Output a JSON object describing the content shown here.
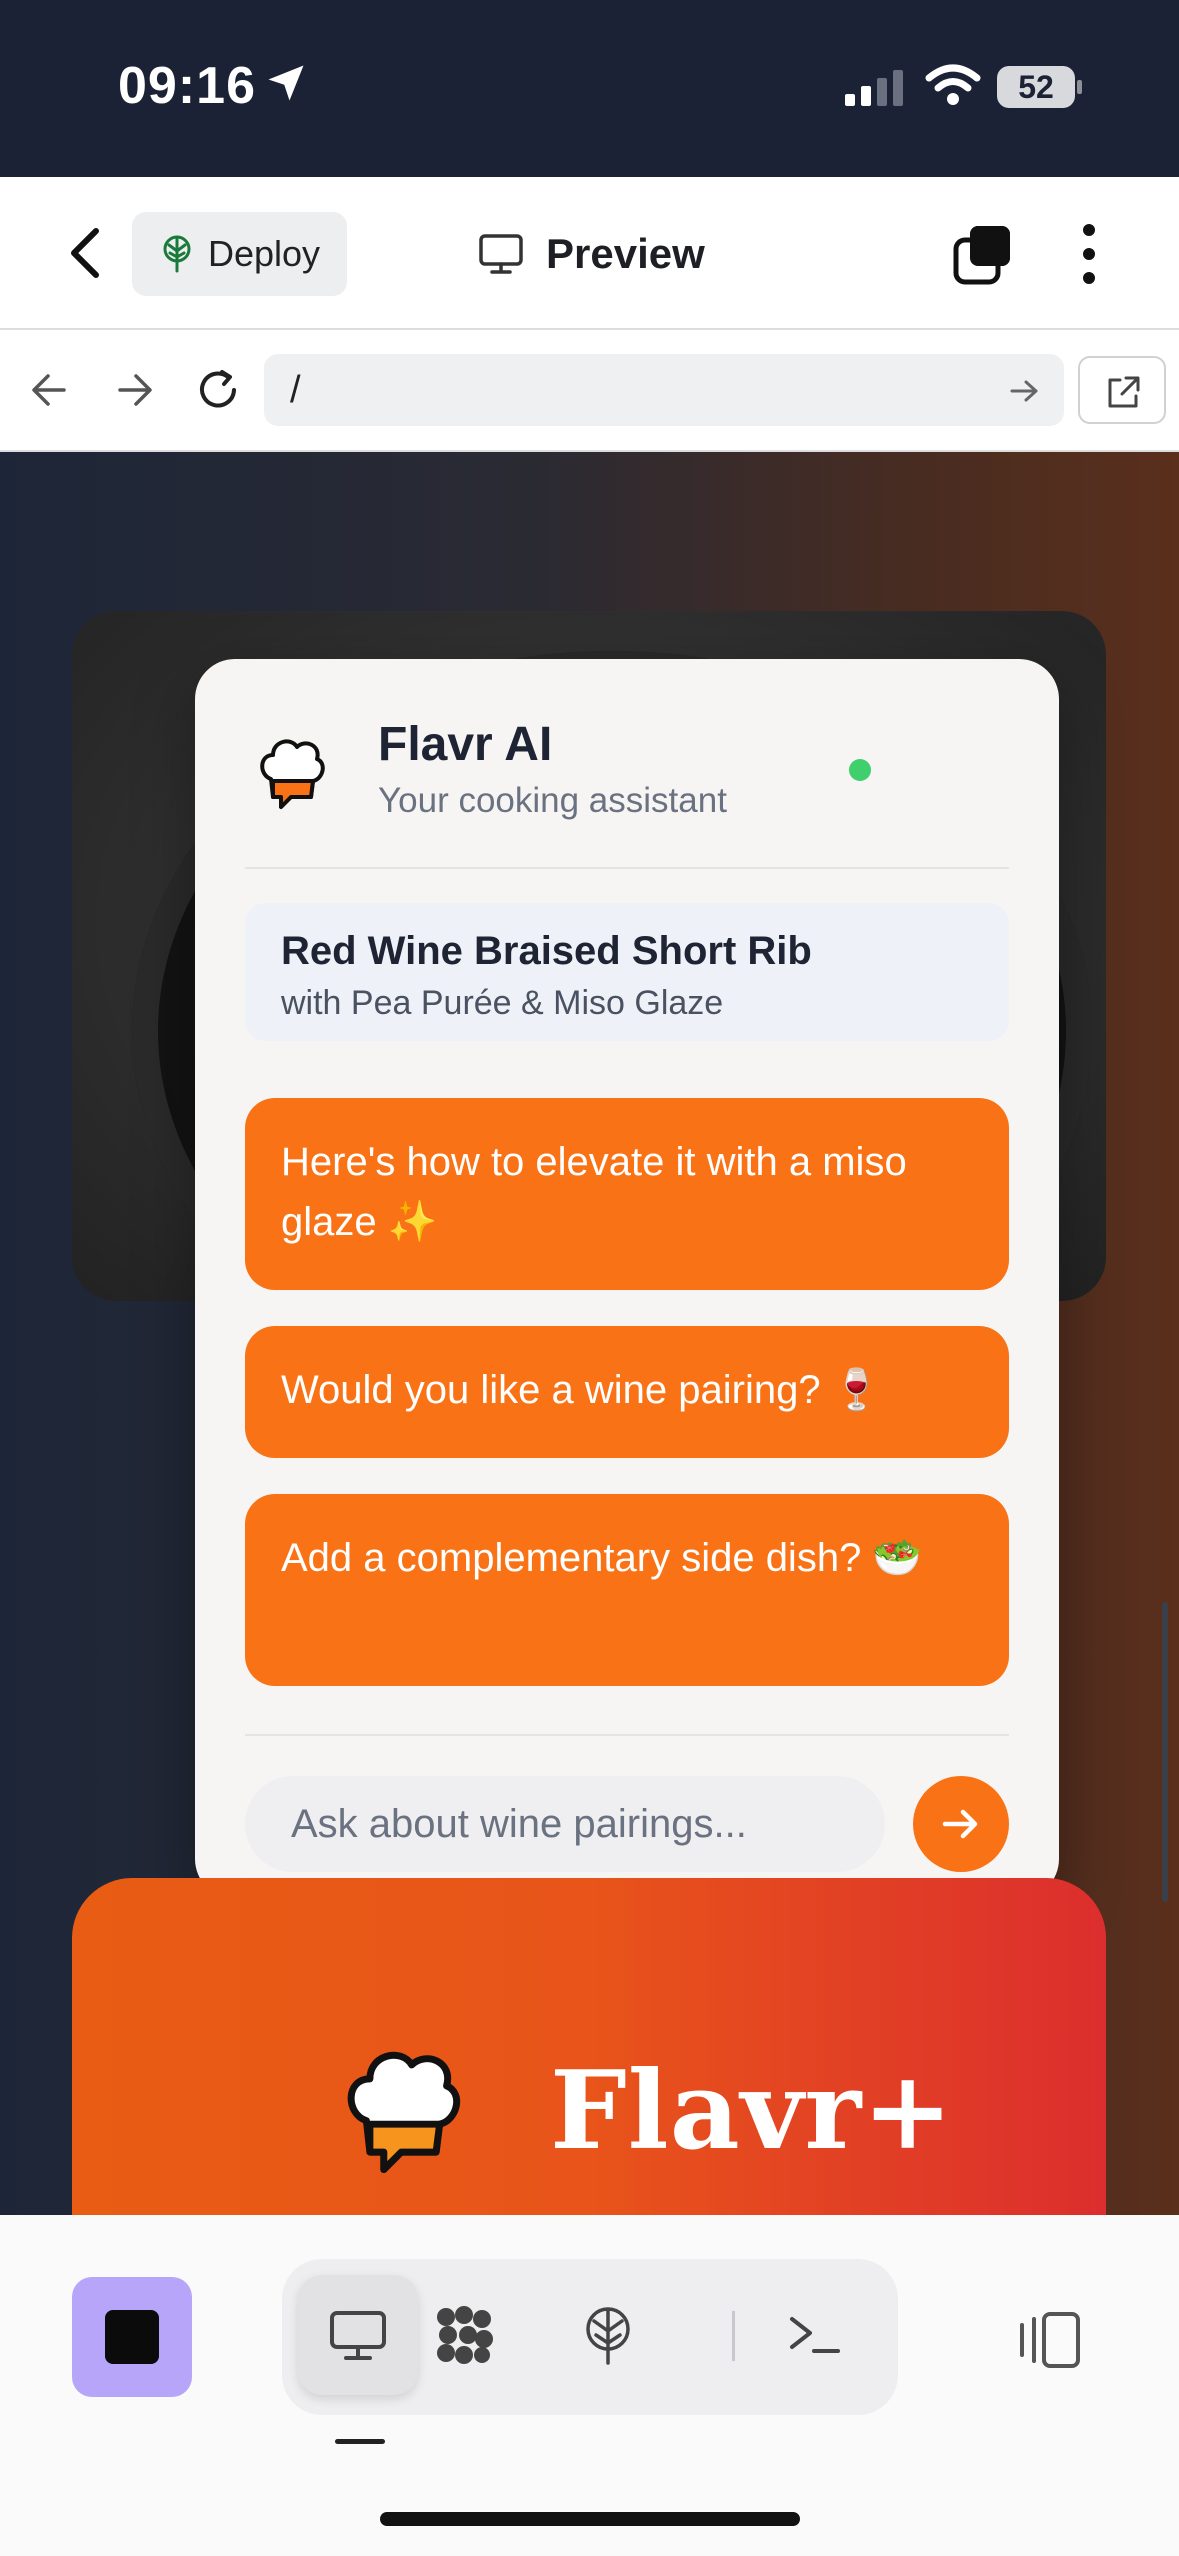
{
  "status_bar": {
    "time": "09:16",
    "battery": "52"
  },
  "app_bar": {
    "deploy_label": "Deploy",
    "preview_label": "Preview"
  },
  "url_bar": {
    "url": "/"
  },
  "chat": {
    "title": "Flavr AI",
    "subtitle": "Your cooking assistant",
    "recipe": {
      "title": "Red Wine Braised Short Rib",
      "subtitle": "with Pea Purée & Miso Glaze"
    },
    "messages": [
      "Here's how to elevate it with a miso glaze ✨",
      "Would you like a wine pairing? 🍷",
      "Add a complementary side dish? 🥗"
    ],
    "input_placeholder": "Ask about wine pairings..."
  },
  "banner": {
    "brand": "Flavr+"
  },
  "colors": {
    "accent": "#f97316",
    "online": "#3fcf6d",
    "status_bg": "#1b2236",
    "stop_button": "#b6a5f8"
  },
  "icons": [
    "location-arrow-icon",
    "signal-icon",
    "wifi-icon",
    "back-chevron-icon",
    "deploy-tree-icon",
    "monitor-icon",
    "tabs-icon",
    "more-vertical-icon",
    "arrow-left-icon",
    "arrow-right-icon",
    "reload-icon",
    "external-link-icon",
    "chef-hat-icon",
    "send-arrow-icon",
    "stop-icon",
    "code-icon",
    "terminal-icon",
    "panel-icon"
  ]
}
